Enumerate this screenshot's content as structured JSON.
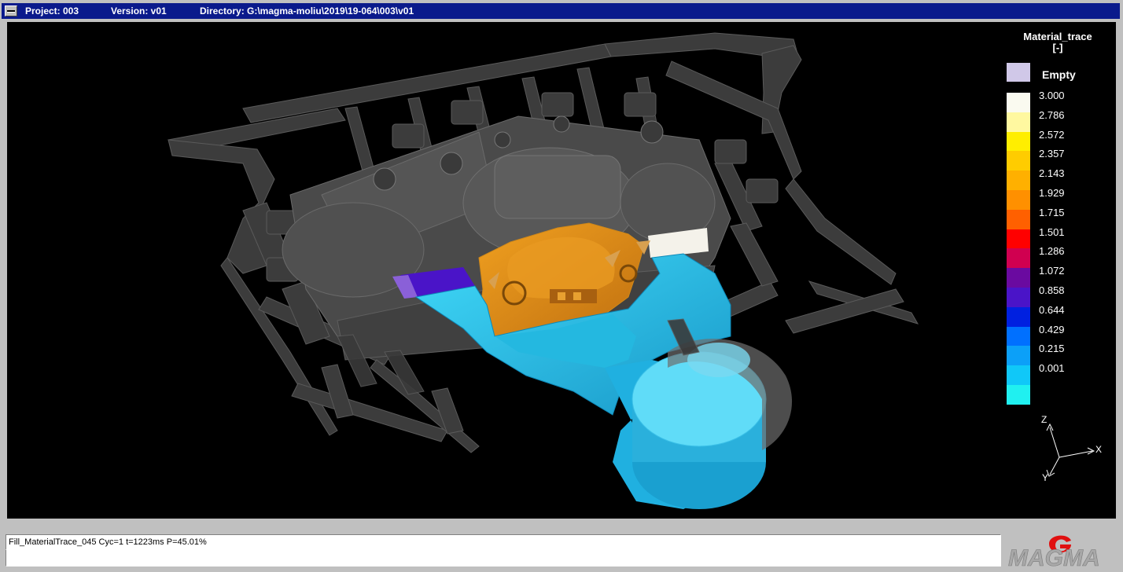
{
  "window": {
    "project": "Project: 003",
    "version": "Version: v01",
    "directory": "Directory: G:\\magma-moliu\\2019\\19-064\\003\\v01"
  },
  "legend": {
    "title": "Material_trace",
    "units": "[-]",
    "empty_label": "Empty",
    "empty_color": "#d0c8e8",
    "entries": [
      {
        "label": "3.000",
        "color": "#fafaf0"
      },
      {
        "label": "2.786",
        "color": "#fff8a0"
      },
      {
        "label": "2.572",
        "color": "#ffee00"
      },
      {
        "label": "2.357",
        "color": "#ffcc00"
      },
      {
        "label": "2.143",
        "color": "#ffb000"
      },
      {
        "label": "1.929",
        "color": "#ff9000"
      },
      {
        "label": "1.715",
        "color": "#ff6000"
      },
      {
        "label": "1.501",
        "color": "#ff0000"
      },
      {
        "label": "1.286",
        "color": "#d00050"
      },
      {
        "label": "1.072",
        "color": "#6a0aa0"
      },
      {
        "label": "0.858",
        "color": "#4a14c8"
      },
      {
        "label": "0.644",
        "color": "#0020e0"
      },
      {
        "label": "0.429",
        "color": "#0070ff"
      },
      {
        "label": "0.215",
        "color": "#0ca0f8"
      },
      {
        "label": "0.001",
        "color": "#10c8f8"
      },
      {
        "label": "",
        "color": "#20f0f0"
      }
    ]
  },
  "axes": {
    "z": "Z",
    "x": "X",
    "y": "Y"
  },
  "status": {
    "line1": "Fill_MaterialTrace_045 Cyc=1 t=1223ms P=45.01%",
    "line2": ""
  },
  "logo": {
    "text": "MAGMA",
    "accent_color": "#e01010"
  }
}
